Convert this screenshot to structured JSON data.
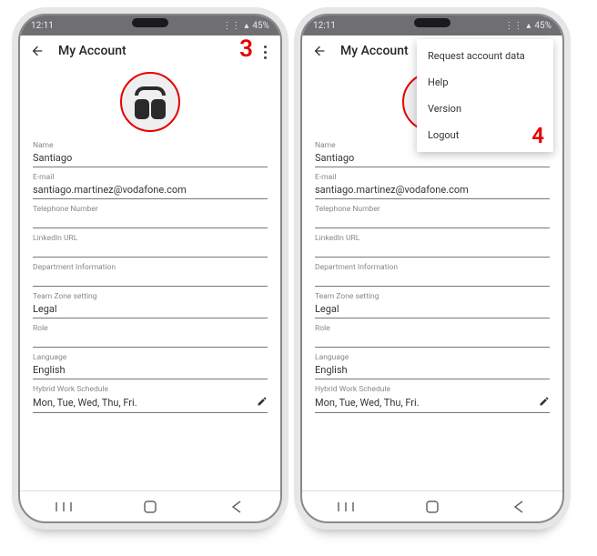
{
  "status": {
    "time": "12:11",
    "battery": "45%"
  },
  "header": {
    "title": "My Account"
  },
  "annotations": {
    "step3": "3",
    "step4": "4"
  },
  "avatar": {
    "alt": "headphones-avatar"
  },
  "fields": {
    "name": {
      "label": "Name",
      "value": "Santiago"
    },
    "email": {
      "label": "E-mail",
      "value": "santiago.martinez@vodafone.com"
    },
    "phone": {
      "label": "Telephone Number",
      "value": ""
    },
    "linkedin": {
      "label": "LinkedIn URL",
      "value": ""
    },
    "dept": {
      "label": "Department Information",
      "value": ""
    },
    "teamzone": {
      "label": "Team Zone setting",
      "value": "Legal"
    },
    "role": {
      "label": "Role",
      "value": ""
    },
    "language": {
      "label": "Language",
      "value": "English"
    },
    "schedule": {
      "label": "Hybrid Work Schedule",
      "value": "Mon, Tue, Wed, Thu, Fri."
    }
  },
  "menu": {
    "request": "Request account data",
    "help": "Help",
    "version": "Version",
    "logout": "Logout"
  }
}
